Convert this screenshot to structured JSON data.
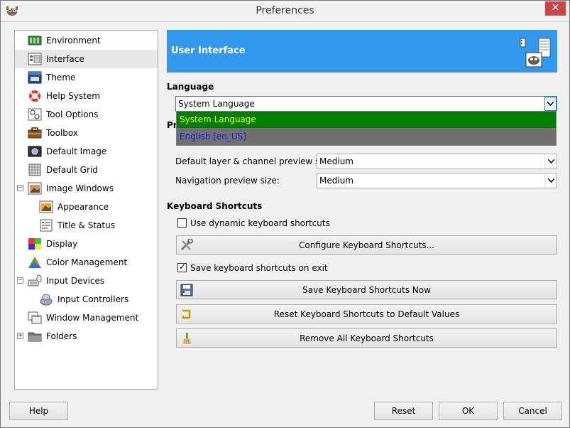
{
  "window": {
    "title": "Preferences",
    "close_label": "✕"
  },
  "sidebar": {
    "items": [
      {
        "label": "Environment",
        "icon": "environment-icon",
        "indent": 0,
        "expander": ""
      },
      {
        "label": "Interface",
        "icon": "interface-icon",
        "indent": 0,
        "expander": "",
        "selected": true
      },
      {
        "label": "Theme",
        "icon": "theme-icon",
        "indent": 0,
        "expander": ""
      },
      {
        "label": "Help System",
        "icon": "help-system-icon",
        "indent": 0,
        "expander": ""
      },
      {
        "label": "Tool Options",
        "icon": "tool-options-icon",
        "indent": 0,
        "expander": ""
      },
      {
        "label": "Toolbox",
        "icon": "toolbox-icon",
        "indent": 0,
        "expander": ""
      },
      {
        "label": "Default Image",
        "icon": "default-image-icon",
        "indent": 0,
        "expander": ""
      },
      {
        "label": "Default Grid",
        "icon": "default-grid-icon",
        "indent": 0,
        "expander": ""
      },
      {
        "label": "Image Windows",
        "icon": "image-windows-icon",
        "indent": 0,
        "expander": "−"
      },
      {
        "label": "Appearance",
        "icon": "appearance-icon",
        "indent": 1,
        "expander": ""
      },
      {
        "label": "Title & Status",
        "icon": "title-status-icon",
        "indent": 1,
        "expander": ""
      },
      {
        "label": "Display",
        "icon": "display-icon",
        "indent": 0,
        "expander": ""
      },
      {
        "label": "Color Management",
        "icon": "color-management-icon",
        "indent": 0,
        "expander": ""
      },
      {
        "label": "Input Devices",
        "icon": "input-devices-icon",
        "indent": 0,
        "expander": "−"
      },
      {
        "label": "Input Controllers",
        "icon": "input-controllers-icon",
        "indent": 1,
        "expander": ""
      },
      {
        "label": "Window Management",
        "icon": "window-management-icon",
        "indent": 0,
        "expander": ""
      },
      {
        "label": "Folders",
        "icon": "folders-icon",
        "indent": 0,
        "expander": "+"
      }
    ]
  },
  "banner": {
    "title": "User Interface"
  },
  "language": {
    "section_label": "Language",
    "selected": "System Language",
    "options": [
      "System Language",
      "English [en_US]"
    ]
  },
  "previews": {
    "section_label_partial": "Pr",
    "layer_label": "Default layer & channel preview size:",
    "layer_value": "Medium",
    "navigation_label": "Navigation preview size:",
    "navigation_value": "Medium"
  },
  "keyboard": {
    "section_label": "Keyboard Shortcuts",
    "dynamic_label": "Use dynamic keyboard shortcuts",
    "dynamic_checked": false,
    "configure_label": "Configure Keyboard Shortcuts...",
    "save_on_exit_label": "Save keyboard shortcuts on exit",
    "save_on_exit_checked": true,
    "save_now_label": "Save Keyboard Shortcuts Now",
    "reset_label": "Reset Keyboard Shortcuts to Default Values",
    "remove_label": "Remove All Keyboard Shortcuts"
  },
  "footer": {
    "help_label": "Help",
    "reset_label": "Reset",
    "ok_label": "OK",
    "cancel_label": "Cancel"
  },
  "colors": {
    "banner": "#3399ee",
    "dropdown_selected_bg": "#008000",
    "dropdown_selected_fg": "#ffff00",
    "dropdown_bg": "#707070",
    "dropdown_other_fg": "#1a1aff",
    "close_button": "#c7474a"
  }
}
